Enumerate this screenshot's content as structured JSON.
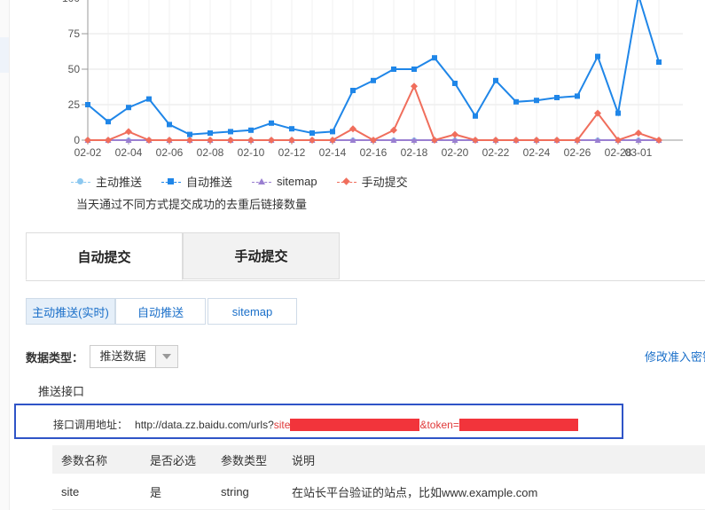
{
  "chart_data": {
    "type": "line",
    "categories": [
      "02-02",
      "02-03",
      "02-04",
      "02-05",
      "02-06",
      "02-07",
      "02-08",
      "02-09",
      "02-10",
      "02-11",
      "02-12",
      "02-13",
      "02-14",
      "02-15",
      "02-16",
      "02-17",
      "02-18",
      "02-19",
      "02-20",
      "02-21",
      "02-22",
      "02-23",
      "02-24",
      "02-25",
      "02-26",
      "02-27",
      "02-28",
      "03-01",
      "03-02"
    ],
    "x_tick_labels": [
      "02-02",
      "02-04",
      "02-06",
      "02-08",
      "02-10",
      "02-12",
      "02-14",
      "02-16",
      "02-18",
      "02-20",
      "02-22",
      "02-24",
      "02-26",
      "02-28",
      "03-01"
    ],
    "y_ticks": [
      0,
      25,
      50,
      75,
      100
    ],
    "y_tick_labels": [
      "0",
      "25",
      "50",
      "75",
      "100"
    ],
    "ylim": [
      0,
      100
    ],
    "grid": true,
    "series": [
      {
        "name": "主动推送",
        "color": "#8cc8f0",
        "marker": "circle",
        "values": [
          0,
          0,
          0,
          0,
          0,
          0,
          0,
          0,
          0,
          0,
          0,
          0,
          0,
          0,
          0,
          0,
          0,
          0,
          0,
          0,
          0,
          0,
          0,
          0,
          0,
          0,
          0,
          0,
          0
        ]
      },
      {
        "name": "自动推送",
        "color": "#1f86e8",
        "marker": "square",
        "values": [
          25,
          13,
          23,
          29,
          11,
          4,
          5,
          6,
          7,
          12,
          8,
          5,
          6,
          35,
          42,
          50,
          50,
          58,
          40,
          17,
          42,
          27,
          28,
          30,
          31,
          59,
          19,
          102,
          55
        ]
      },
      {
        "name": "sitemap",
        "color": "#9a7fd1",
        "marker": "triangle",
        "values": [
          0,
          0,
          0,
          0,
          0,
          0,
          0,
          0,
          0,
          0,
          0,
          0,
          0,
          0,
          0,
          0,
          0,
          0,
          0,
          0,
          0,
          0,
          0,
          0,
          0,
          0,
          0,
          0,
          0
        ]
      },
      {
        "name": "手动提交",
        "color": "#f06e5c",
        "marker": "diamond",
        "values": [
          0,
          0,
          6,
          0,
          0,
          0,
          0,
          0,
          0,
          0,
          0,
          0,
          0,
          8,
          0,
          7,
          38,
          0,
          4,
          0,
          0,
          0,
          0,
          0,
          0,
          19,
          0,
          5,
          0
        ]
      }
    ],
    "legend_position": "bottom-left"
  },
  "chart_caption": "当天通过不同方式提交成功的去重后链接数量",
  "tabs": [
    {
      "label": "自动提交",
      "active": true
    },
    {
      "label": "手动提交",
      "active": false
    }
  ],
  "subtabs": [
    {
      "label": "主动推送(实时)",
      "active": true
    },
    {
      "label": "自动推送",
      "active": false
    },
    {
      "label": "sitemap",
      "active": false
    }
  ],
  "data_type": {
    "label": "数据类型：",
    "selected": "推送数据"
  },
  "modify_link": "修改准入密钥",
  "interface_title": "推送接口",
  "endpoint": {
    "label": "接口调用地址：",
    "url_prefix": "http://data.zz.baidu.com/urls?",
    "site_param": "site",
    "token_param": "&token="
  },
  "table": {
    "headers": [
      "参数名称",
      "是否必选",
      "参数类型",
      "说明"
    ],
    "rows": [
      [
        "site",
        "是",
        "string",
        "在站长平台验证的站点，比如www.example.com"
      ]
    ]
  }
}
